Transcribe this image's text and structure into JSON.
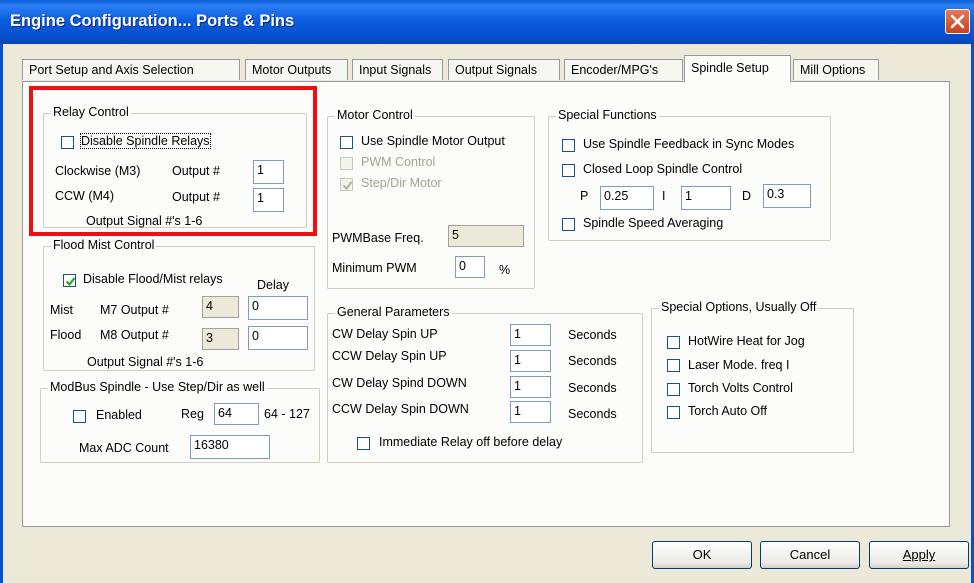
{
  "window": {
    "title": "Engine Configuration... Ports & Pins"
  },
  "tabs": [
    {
      "label": "Port Setup and Axis Selection"
    },
    {
      "label": "Motor Outputs"
    },
    {
      "label": "Input Signals"
    },
    {
      "label": "Output Signals"
    },
    {
      "label": "Encoder/MPG's"
    },
    {
      "label": "Spindle Setup"
    },
    {
      "label": "Mill Options"
    }
  ],
  "active_tab": "Spindle Setup",
  "relay_control": {
    "legend": "Relay Control",
    "disable_label": "Disable Spindle Relays",
    "disable_checked": false,
    "cw_label": "Clockwise (M3)",
    "ccw_label": "CCW (M4)",
    "output_label": "Output #",
    "cw_output": "1",
    "ccw_output": "1",
    "signal_note": "Output Signal #'s 1-6"
  },
  "flood_mist": {
    "legend": "Flood Mist Control",
    "disable_label": "Disable Flood/Mist relays",
    "disable_checked": true,
    "delay_label": "Delay",
    "mist_label": "Mist",
    "mist_output_label": "M7 Output #",
    "mist_output": "4",
    "mist_delay": "0",
    "flood_label": "Flood",
    "flood_output_label": "M8 Output #",
    "flood_output": "3",
    "flood_delay": "0",
    "signal_note": "Output Signal #'s 1-6"
  },
  "modbus": {
    "legend": "ModBus Spindle - Use Step/Dir as well",
    "enabled_label": "Enabled",
    "enabled_checked": false,
    "reg_label": "Reg",
    "reg_value": "64",
    "reg_range": "64 - 127",
    "max_adc_label": "Max ADC Count",
    "max_adc_value": "16380"
  },
  "motor_control": {
    "legend": "Motor Control",
    "use_spindle_label": "Use Spindle Motor Output",
    "use_spindle_checked": false,
    "pwm_control_label": "PWM Control",
    "step_dir_label": "Step/Dir Motor",
    "step_dir_checked": true,
    "pwm_base_label": "PWMBase Freq.",
    "pwm_base_value": "5",
    "min_pwm_label": "Minimum PWM",
    "min_pwm_value": "0",
    "percent": "%"
  },
  "special_functions": {
    "legend": "Special Functions",
    "feedback_label": "Use Spindle Feedback in Sync Modes",
    "closed_loop_label": "Closed Loop Spindle Control",
    "p_label": "P",
    "p_value": "0.25",
    "i_label": "I",
    "i_value": "1",
    "d_label": "D",
    "d_value": "0.3",
    "averaging_label": "Spindle Speed Averaging"
  },
  "general_params": {
    "legend": "General Parameters",
    "rows": [
      {
        "label": "CW Delay Spin UP",
        "value": "1",
        "unit": "Seconds"
      },
      {
        "label": "CCW Delay Spin UP",
        "value": "1",
        "unit": "Seconds"
      },
      {
        "label": "CW Delay Spind DOWN",
        "value": "1",
        "unit": "Seconds"
      },
      {
        "label": "CCW Delay Spin DOWN",
        "value": "1",
        "unit": "Seconds"
      }
    ],
    "immediate_label": "Immediate Relay off before delay"
  },
  "special_options": {
    "legend": "Special Options, Usually Off",
    "items": [
      {
        "label": "HotWire Heat for Jog"
      },
      {
        "label": "Laser Mode. freq I"
      },
      {
        "label": "Torch Volts Control"
      },
      {
        "label": "Torch Auto Off"
      }
    ]
  },
  "buttons": {
    "ok": "OK",
    "cancel": "Cancel",
    "apply": "Apply"
  },
  "colors": {
    "title_bar": "#0650d0",
    "highlight": "#ee1010"
  }
}
